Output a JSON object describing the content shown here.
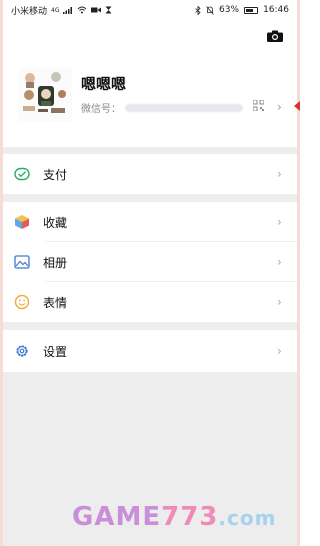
{
  "status_bar": {
    "carrier": "小米移动",
    "network": "4G",
    "battery": "63%",
    "time": "16:46"
  },
  "profile": {
    "nickname": "嗯嗯嗯",
    "wechat_id_label": "微信号：",
    "chevron": "›"
  },
  "menu": {
    "pay": "支付",
    "favorites": "收藏",
    "album": "相册",
    "stickers": "表情",
    "settings": "设置",
    "chevron": "›"
  },
  "watermark": {
    "part1": "GAME",
    "part2": "773",
    "part3": ".com"
  },
  "colors": {
    "accent_green": "#2aae67",
    "divider_gray": "#ededed",
    "settings_blue": "#3d7bd1",
    "sticker_orange": "#f2a93b"
  }
}
